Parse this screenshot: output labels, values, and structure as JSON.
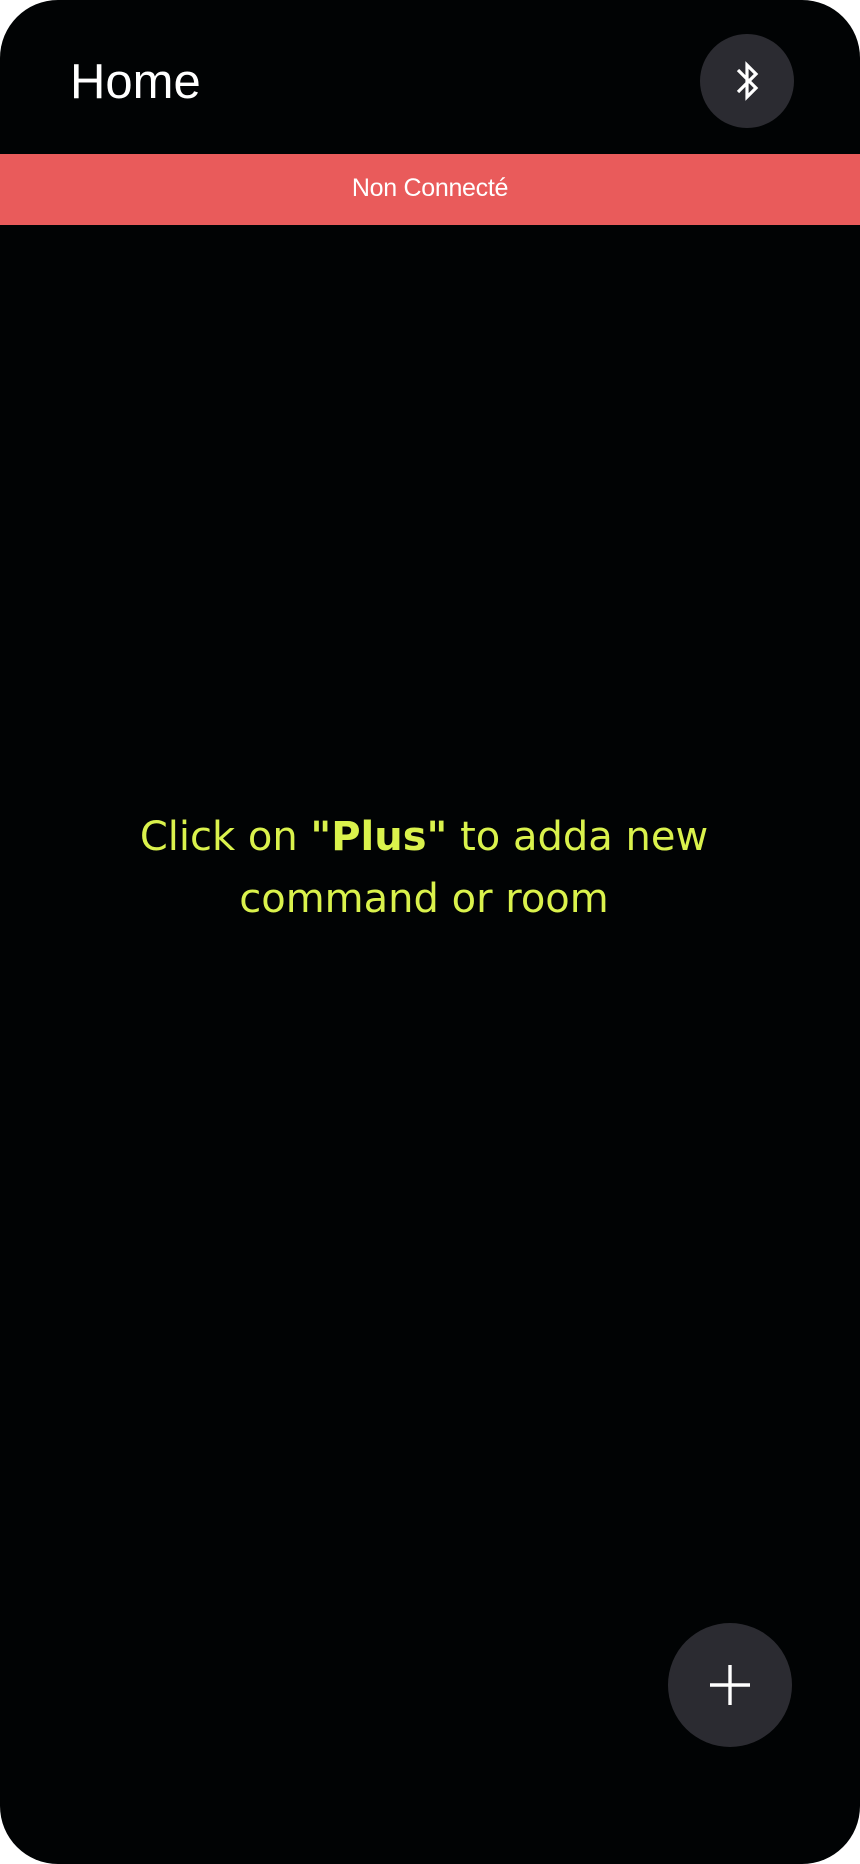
{
  "header": {
    "title": "Home",
    "bluetooth_button": {
      "icon": "bluetooth-icon"
    }
  },
  "status_banner": {
    "text": "Non Connecté",
    "background_color": "#e95b5b"
  },
  "empty_state": {
    "prefix": "Click on ",
    "highlight": "\"Plus\"",
    "line1_suffix": " to adda new",
    "line2": "command or room",
    "color": "#daf24c"
  },
  "fab": {
    "icon": "plus-icon"
  },
  "colors": {
    "background": "#010304",
    "button_background": "#2b2b31",
    "text_primary": "#ffffff"
  }
}
